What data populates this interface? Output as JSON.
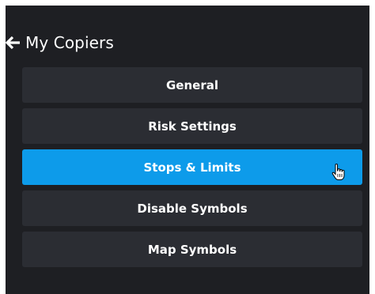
{
  "header": {
    "back_icon": "arrow-left-icon",
    "title": "My Copiers"
  },
  "menu": {
    "items": [
      {
        "label": "General",
        "active": false
      },
      {
        "label": "Risk Settings",
        "active": false
      },
      {
        "label": "Stops & Limits",
        "active": true
      },
      {
        "label": "Disable Symbols",
        "active": false
      },
      {
        "label": "Map Symbols",
        "active": false
      }
    ]
  },
  "colors": {
    "panel_background": "#1e1f23",
    "item_background": "#2b2d33",
    "active_item_background": "#0d9bea",
    "text": "#ffffff"
  },
  "cursor": {
    "icon": "hand-pointer-icon"
  }
}
